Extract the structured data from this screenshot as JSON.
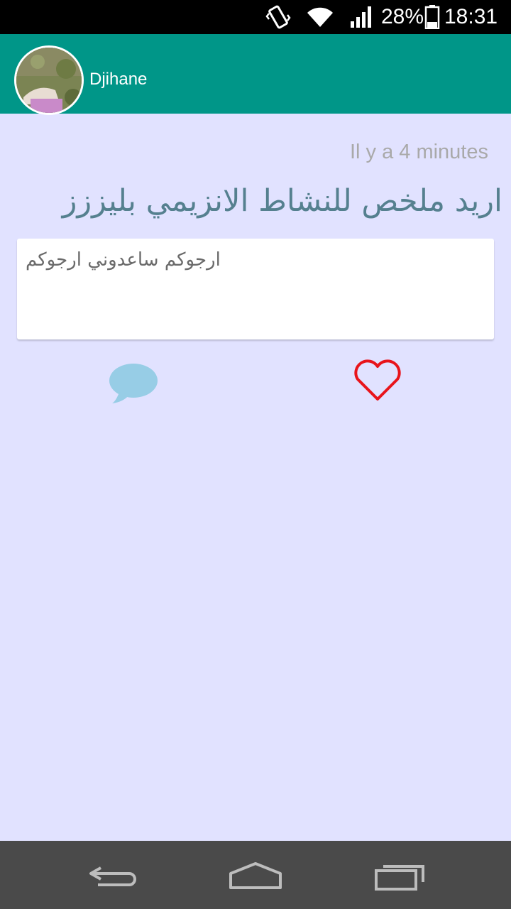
{
  "status_bar": {
    "battery_percent": "28%",
    "time": "18:31",
    "icons": [
      "vibrate-icon",
      "wifi-icon",
      "signal-icon",
      "battery-icon"
    ]
  },
  "header": {
    "user_name": "Djihane",
    "avatar": "avatar-photo"
  },
  "post": {
    "timestamp": "Il y a 4 minutes",
    "title": "اريد ملخص للنشاط الانزيمي بليززز",
    "body": "ارجوكم ساعدوني ارجوكم",
    "actions": [
      "comment-icon",
      "heart-icon"
    ]
  },
  "colors": {
    "header": "#009688",
    "background": "#e1e2ff",
    "title": "#55808f",
    "comment_icon": "#97cde6",
    "heart_icon": "#e8141b"
  },
  "nav_bar": {
    "icons": [
      "back-icon",
      "home-icon",
      "recents-icon"
    ]
  }
}
